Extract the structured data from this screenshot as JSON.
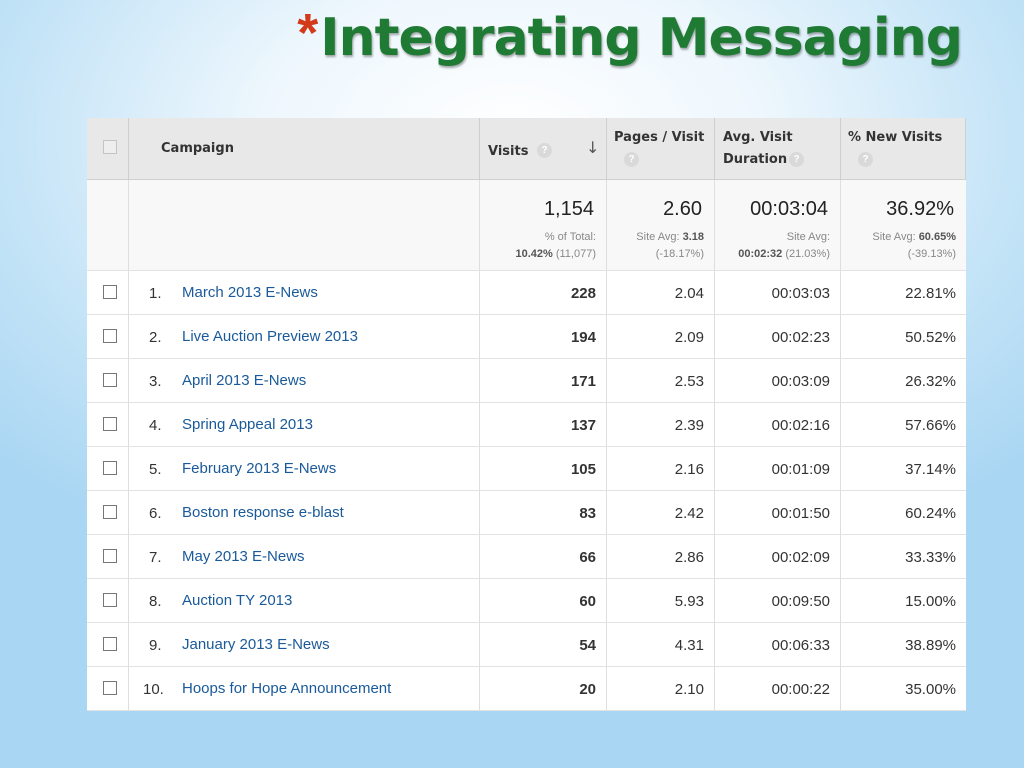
{
  "slide": {
    "title_star": "*",
    "title": "Integrating Messaging"
  },
  "table": {
    "headers": {
      "campaign": "Campaign",
      "visits": "Visits",
      "pages_visit": "Pages / Visit",
      "avg_visit_duration_1": "Avg. Visit",
      "avg_visit_duration_2": "Duration",
      "new_visits": "% New Visits",
      "help_glyph": "?",
      "sort_glyph": "↓"
    },
    "summary": {
      "visits": "1,154",
      "visits_note_1": "% of Total:",
      "visits_note_2_bold": "10.42%",
      "visits_note_2_rest": " (11,077)",
      "pages_visit": "2.60",
      "pages_note_1_prefix": "Site Avg: ",
      "pages_note_1_bold": "3.18",
      "pages_note_2": "(-18.17%)",
      "duration": "00:03:04",
      "duration_note_1": "Site Avg:",
      "duration_note_2_bold": "00:02:32",
      "duration_note_2_rest": " (21.03%)",
      "new_visits": "36.92%",
      "new_note_1_prefix": "Site Avg: ",
      "new_note_1_bold": "60.65%",
      "new_note_2": "(-39.13%)"
    },
    "rows": [
      {
        "rank": "1.",
        "campaign": "March 2013 E-News",
        "visits": "228",
        "pages_visit": "2.04",
        "duration": "00:03:03",
        "new_visits": "22.81%"
      },
      {
        "rank": "2.",
        "campaign": "Live Auction Preview 2013",
        "visits": "194",
        "pages_visit": "2.09",
        "duration": "00:02:23",
        "new_visits": "50.52%"
      },
      {
        "rank": "3.",
        "campaign": "April 2013 E-News",
        "visits": "171",
        "pages_visit": "2.53",
        "duration": "00:03:09",
        "new_visits": "26.32%"
      },
      {
        "rank": "4.",
        "campaign": "Spring Appeal 2013",
        "visits": "137",
        "pages_visit": "2.39",
        "duration": "00:02:16",
        "new_visits": "57.66%"
      },
      {
        "rank": "5.",
        "campaign": "February 2013 E-News",
        "visits": "105",
        "pages_visit": "2.16",
        "duration": "00:01:09",
        "new_visits": "37.14%"
      },
      {
        "rank": "6.",
        "campaign": "Boston response e-blast",
        "visits": "83",
        "pages_visit": "2.42",
        "duration": "00:01:50",
        "new_visits": "60.24%"
      },
      {
        "rank": "7.",
        "campaign": "May 2013 E-News",
        "visits": "66",
        "pages_visit": "2.86",
        "duration": "00:02:09",
        "new_visits": "33.33%"
      },
      {
        "rank": "8.",
        "campaign": "Auction TY 2013",
        "visits": "60",
        "pages_visit": "5.93",
        "duration": "00:09:50",
        "new_visits": "15.00%"
      },
      {
        "rank": "9.",
        "campaign": "January 2013 E-News",
        "visits": "54",
        "pages_visit": "4.31",
        "duration": "00:06:33",
        "new_visits": "38.89%"
      },
      {
        "rank": "10.",
        "campaign": "Hoops for Hope Announcement",
        "visits": "20",
        "pages_visit": "2.10",
        "duration": "00:00:22",
        "new_visits": "35.00%"
      }
    ]
  }
}
